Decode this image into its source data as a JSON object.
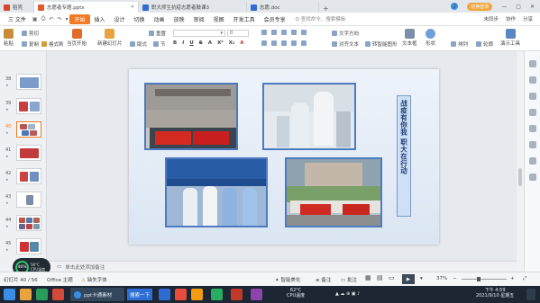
{
  "tabs": {
    "home": "稻壳",
    "active_file": "志愿者专题.pptx",
    "file2": "职大师生抗疫志愿者鼓课3",
    "file3": "志愿.doc",
    "user": "切换登录"
  },
  "menu": {
    "file": "三 文件",
    "items": [
      "开始",
      "插入",
      "设计",
      "切换",
      "动画",
      "放映",
      "审阅",
      "视图",
      "开发工具",
      "会员专享"
    ],
    "search": "Q 查找命令、搜索模板",
    "right": [
      "未同步",
      "协作",
      "分享"
    ]
  },
  "ribbon": {
    "paste": "粘贴",
    "cut": "剪切",
    "copy": "复制",
    "format_painter": "格式刷",
    "from_current": "当页开始",
    "new_slide": "新建幻灯片",
    "layout": "版式",
    "section": "节",
    "reset": "重置",
    "font_size": "0",
    "text_direction": "文字方向",
    "align_text": "对齐文本",
    "convert_smartart": "转智能图形",
    "text_box": "文本框",
    "shape": "形状",
    "arrange": "排列",
    "outline": "轮廓",
    "presenter": "演示工具",
    "font_btns": [
      "B",
      "I",
      "U",
      "S",
      "A",
      "X²",
      "X₂",
      "A"
    ]
  },
  "thumbnails": [
    {
      "num": "38"
    },
    {
      "num": "39"
    },
    {
      "num": "40"
    },
    {
      "num": "41"
    },
    {
      "num": "42"
    },
    {
      "num": "43"
    },
    {
      "num": "44"
    },
    {
      "num": "45"
    }
  ],
  "slide": {
    "vertical_text": "战疫有你我 职大在行动"
  },
  "notes": {
    "placeholder": "单击此处添加备注"
  },
  "perf": {
    "percent": "46%",
    "line1": "56°C",
    "line2": "CPU温度"
  },
  "status": {
    "slide_count": "幻灯片 40 / 56",
    "theme": "Office 主题",
    "missing_font": "缺失字体",
    "smart_beautify": "智能美化",
    "notes": "备注",
    "comments": "批注",
    "zoom": "37%"
  },
  "taskbar": {
    "task_label": "ppt卡通素材",
    "search_label": "搜索一下",
    "temp": "62°C",
    "cpu": "CPU温度",
    "time": "下午 4:59",
    "date": "2021/9/10 星期五"
  },
  "colors": {
    "accent": "#f17a23",
    "photo_border": "#4e7bbf",
    "slide_text": "#1d3c78"
  }
}
